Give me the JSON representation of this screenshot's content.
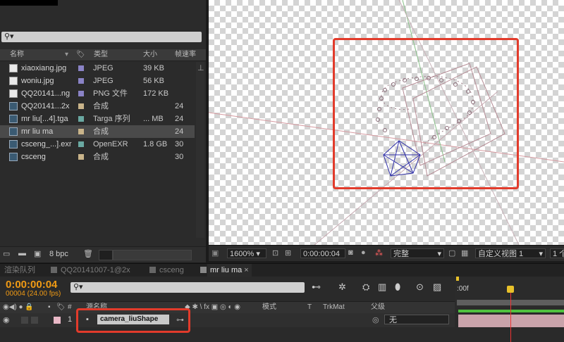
{
  "project": {
    "search_glyph": "⚲▾",
    "columns": {
      "name": "名称",
      "type": "类型",
      "size": "大小",
      "fps": "帧速率"
    },
    "rows": [
      {
        "name": "xiaoxiang.jpg",
        "type": "JPEG",
        "size": "39 KB",
        "fps": "",
        "kind": "doc",
        "label": "#8a83c6"
      },
      {
        "name": "woniu.jpg",
        "type": "JPEG",
        "size": "56 KB",
        "fps": "",
        "kind": "doc",
        "label": "#8a83c6"
      },
      {
        "name": "QQ20141...ng",
        "type": "PNG 文件",
        "size": "172 KB",
        "fps": "",
        "kind": "doc",
        "label": "#8a83c6"
      },
      {
        "name": "QQ20141...2x",
        "type": "合成",
        "size": "",
        "fps": "24",
        "kind": "comp",
        "label": "#c9b48a"
      },
      {
        "name": "mr liu[...4].tga",
        "type": "Targa 序列",
        "size": "... MB",
        "fps": "24",
        "kind": "comp",
        "label": "#6aa9a2"
      },
      {
        "name": "mr liu ma",
        "type": "合成",
        "size": "",
        "fps": "24",
        "kind": "comp",
        "label": "#c9b48a",
        "selected": true
      },
      {
        "name": "csceng_...].exr",
        "type": "OpenEXR",
        "size": "1.8 GB",
        "fps": "30",
        "kind": "comp",
        "label": "#6aa9a2"
      },
      {
        "name": "csceng",
        "type": "合成",
        "size": "",
        "fps": "30",
        "kind": "comp",
        "label": "#c9b48a"
      }
    ],
    "bit_depth": "8 bpc"
  },
  "viewer": {
    "zoom": "1600%",
    "timecode": "0:00:00:04",
    "quality": "完整",
    "view": "自定义视图 1",
    "views_count": "1 个"
  },
  "tabs": [
    "渲染队列",
    "QQ20141007-1@2x",
    "csceng",
    "mr liu ma"
  ],
  "timeline": {
    "timecode": "0:00:00:04",
    "frame_info": "00004 (24.00 fps)",
    "search_glyph": "⚲▾",
    "columns": {
      "source": "源名称",
      "mode": "模式",
      "t": "T",
      "trkmat": "TrkMat",
      "parent": "父级"
    },
    "ruler_start": ":00f",
    "layer": {
      "index": "1",
      "name": "camera_liuShape",
      "parent": "无"
    }
  },
  "colors": {
    "accent_orange": "#f09a14",
    "highlight_red": "#e23b2b",
    "track_green": "#4ec23e"
  }
}
